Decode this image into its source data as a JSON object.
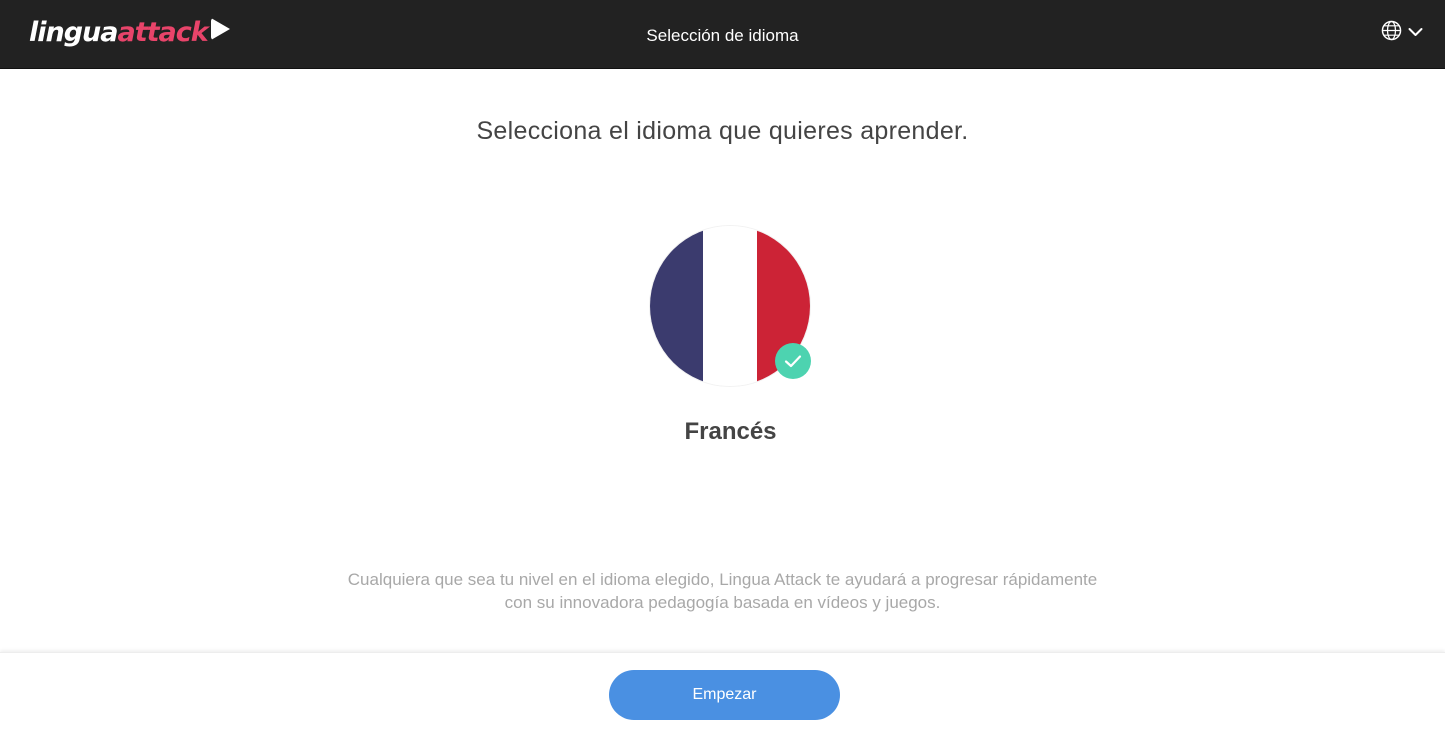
{
  "header": {
    "logo_part1": "lingua",
    "logo_part2": "attack",
    "title": "Selección de idioma",
    "language_menu_icon": "globe-icon",
    "language_menu_chevron": "chevron-down-icon"
  },
  "main": {
    "heading": "Selecciona el idioma que quieres aprender.",
    "language": {
      "name": "Francés",
      "flag_colors": [
        "#3b3b6e",
        "#ffffff",
        "#cc2336"
      ],
      "selected": true
    },
    "description_line1": "Cualquiera que sea tu nivel en el idioma elegido, Lingua Attack te ayudará a progresar rápidamente",
    "description_line2": "con su innovadora pedagogía basada en vídeos y juegos."
  },
  "footer": {
    "start_label": "Empezar"
  },
  "colors": {
    "topbar": "#222222",
    "brand_pink": "#e8446a",
    "accent_blue": "#4a90e2",
    "check_green": "#4dd3b0"
  }
}
